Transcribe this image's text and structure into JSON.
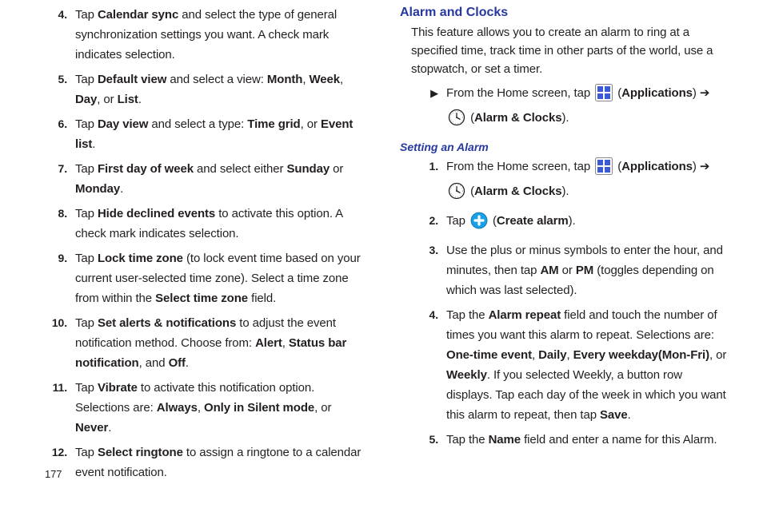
{
  "pageNumber": "177",
  "left": {
    "items": [
      {
        "n": "4.",
        "segs": [
          [
            "t",
            "Tap "
          ],
          [
            "b",
            "Calendar sync"
          ],
          [
            "t",
            " and select the type of general synchronization settings you want. A check mark indicates selection."
          ]
        ]
      },
      {
        "n": "5.",
        "segs": [
          [
            "t",
            "Tap "
          ],
          [
            "b",
            "Default view"
          ],
          [
            "t",
            " and select a view: "
          ],
          [
            "b",
            "Month"
          ],
          [
            "t",
            ", "
          ],
          [
            "b",
            "Week"
          ],
          [
            "t",
            ", "
          ],
          [
            "b",
            "Day"
          ],
          [
            "t",
            ", or "
          ],
          [
            "b",
            "List"
          ],
          [
            "t",
            "."
          ]
        ]
      },
      {
        "n": "6.",
        "segs": [
          [
            "t",
            "Tap "
          ],
          [
            "b",
            "Day view"
          ],
          [
            "t",
            " and select a type: "
          ],
          [
            "b",
            "Time grid"
          ],
          [
            "t",
            ", or "
          ],
          [
            "b",
            "Event list"
          ],
          [
            "t",
            "."
          ]
        ]
      },
      {
        "n": "7.",
        "segs": [
          [
            "t",
            "Tap "
          ],
          [
            "b",
            "First day of week"
          ],
          [
            "t",
            " and select either "
          ],
          [
            "b",
            "Sunday"
          ],
          [
            "t",
            " or "
          ],
          [
            "b",
            "Monday"
          ],
          [
            "t",
            "."
          ]
        ]
      },
      {
        "n": "8.",
        "segs": [
          [
            "t",
            "Tap "
          ],
          [
            "b",
            "Hide declined events"
          ],
          [
            "t",
            " to activate this option. A check mark indicates selection."
          ]
        ]
      },
      {
        "n": "9.",
        "segs": [
          [
            "t",
            "Tap "
          ],
          [
            "b",
            "Lock time zone"
          ],
          [
            "t",
            " (to lock event time based on your current user-selected time zone). Select a time zone from within the "
          ],
          [
            "b",
            "Select time zone"
          ],
          [
            "t",
            " field."
          ]
        ]
      },
      {
        "n": "10.",
        "segs": [
          [
            "t",
            "Tap "
          ],
          [
            "b",
            "Set alerts & notifications"
          ],
          [
            "t",
            " to adjust the event notification method. Choose from: "
          ],
          [
            "b",
            "Alert"
          ],
          [
            "t",
            ", "
          ],
          [
            "b",
            "Status bar notification"
          ],
          [
            "t",
            ", and "
          ],
          [
            "b",
            "Off"
          ],
          [
            "t",
            "."
          ]
        ]
      },
      {
        "n": "11.",
        "segs": [
          [
            "t",
            "Tap "
          ],
          [
            "b",
            "Vibrate"
          ],
          [
            "t",
            " to activate this notification option. Selections are: "
          ],
          [
            "b",
            "Always"
          ],
          [
            "t",
            ", "
          ],
          [
            "b",
            "Only in Silent mode"
          ],
          [
            "t",
            ", or "
          ],
          [
            "b",
            "Never"
          ],
          [
            "t",
            "."
          ]
        ]
      },
      {
        "n": "12.",
        "segs": [
          [
            "t",
            "Tap "
          ],
          [
            "b",
            "Select ringtone"
          ],
          [
            "t",
            " to assign a ringtone to a calendar event notification."
          ]
        ]
      }
    ]
  },
  "right": {
    "heading": "Alarm and Clocks",
    "intro": "This feature allows you to create an alarm to ring at a specified time, track time in other parts of the world, use a stopwatch, or set a timer.",
    "topStep": {
      "segs": [
        [
          "t",
          "From the Home screen, tap "
        ],
        [
          "icon",
          "apps"
        ],
        [
          "t",
          " ("
        ],
        [
          "b",
          "Applications"
        ],
        [
          "t",
          ") ➔ "
        ],
        [
          "icon",
          "clock"
        ],
        [
          "t",
          " ("
        ],
        [
          "b",
          "Alarm & Clocks"
        ],
        [
          "t",
          ")."
        ]
      ]
    },
    "subheading": "Setting an Alarm",
    "items": [
      {
        "n": "1.",
        "segs": [
          [
            "t",
            "From the Home screen, tap "
          ],
          [
            "icon",
            "apps"
          ],
          [
            "t",
            " ("
          ],
          [
            "b",
            "Applications"
          ],
          [
            "t",
            ") ➔ "
          ],
          [
            "icon",
            "clock"
          ],
          [
            "t",
            " ("
          ],
          [
            "b",
            "Alarm & Clocks"
          ],
          [
            "t",
            ")."
          ]
        ]
      },
      {
        "n": "2.",
        "segs": [
          [
            "t",
            "Tap "
          ],
          [
            "icon",
            "plus"
          ],
          [
            "t",
            " ("
          ],
          [
            "b",
            "Create alarm"
          ],
          [
            "t",
            ")."
          ]
        ]
      },
      {
        "n": "3.",
        "segs": [
          [
            "t",
            "Use the plus or minus symbols to enter the hour, and minutes, then tap "
          ],
          [
            "b",
            "AM"
          ],
          [
            "t",
            " or "
          ],
          [
            "b",
            "PM"
          ],
          [
            "t",
            " (toggles depending on which was last selected)."
          ]
        ]
      },
      {
        "n": "4.",
        "segs": [
          [
            "t",
            "Tap the "
          ],
          [
            "b",
            "Alarm repeat"
          ],
          [
            "t",
            " field and touch the number of times you want this alarm to repeat. Selections are: "
          ],
          [
            "b",
            "One-time event"
          ],
          [
            "t",
            ", "
          ],
          [
            "b",
            "Daily"
          ],
          [
            "t",
            ", "
          ],
          [
            "b",
            "Every weekday(Mon-Fri)"
          ],
          [
            "t",
            ", or "
          ],
          [
            "b",
            "Weekly"
          ],
          [
            "t",
            ". If you selected Weekly, a button row displays. Tap each day of the week in which you want this alarm to repeat, then tap "
          ],
          [
            "b",
            "Save"
          ],
          [
            "t",
            "."
          ]
        ]
      },
      {
        "n": "5.",
        "segs": [
          [
            "t",
            "Tap the "
          ],
          [
            "b",
            "Name"
          ],
          [
            "t",
            " field and enter a name for this Alarm."
          ]
        ]
      }
    ]
  },
  "bulletGlyph": "▶"
}
